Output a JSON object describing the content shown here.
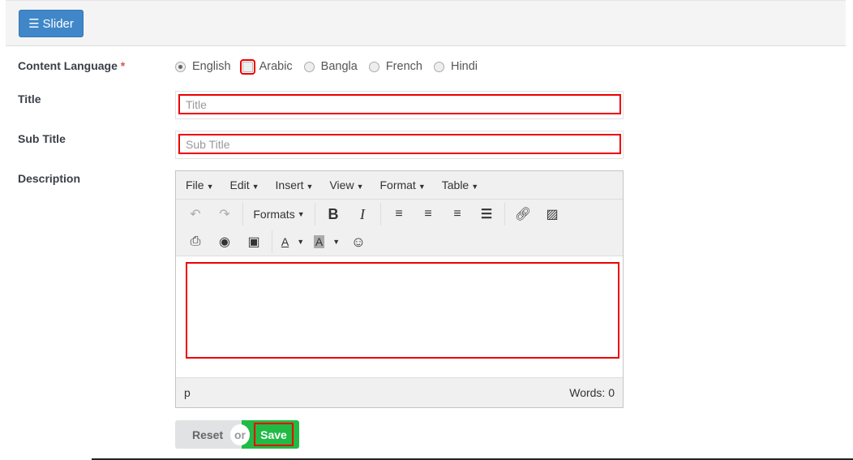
{
  "header": {
    "slider_button": "Slider"
  },
  "form": {
    "content_language_label": "Content Language",
    "required_mark": "*",
    "languages": [
      {
        "label": "English",
        "checked": true
      },
      {
        "label": "Arabic",
        "checked": false
      },
      {
        "label": "Bangla",
        "checked": false
      },
      {
        "label": "French",
        "checked": false
      },
      {
        "label": "Hindi",
        "checked": false
      }
    ],
    "title_label": "Title",
    "title_placeholder": "Title",
    "title_value": "",
    "subtitle_label": "Sub Title",
    "subtitle_placeholder": "Sub Title",
    "subtitle_value": "",
    "description_label": "Description"
  },
  "editor": {
    "menus": [
      "File",
      "Edit",
      "Insert",
      "View",
      "Format",
      "Table"
    ],
    "formats_label": "Formats",
    "status_path": "p",
    "word_count": "Words: 0"
  },
  "actions": {
    "reset": "Reset",
    "or": "or",
    "save": "Save"
  }
}
